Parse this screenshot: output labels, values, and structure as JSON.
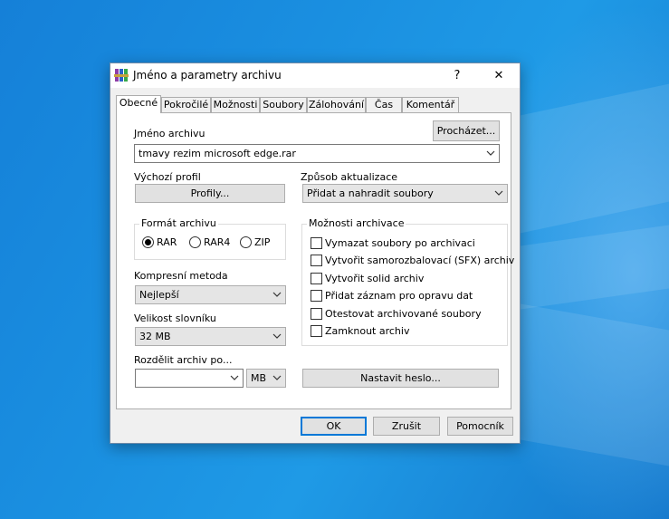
{
  "dialog": {
    "title": "Jméno a parametry archivu",
    "help_glyph": "?",
    "close_glyph": "✕"
  },
  "tabs": [
    "Obecné",
    "Pokročilé",
    "Možnosti",
    "Soubory",
    "Zálohování",
    "Čas",
    "Komentář"
  ],
  "active_tab": "Obecné",
  "archive_name": {
    "label": "Jméno archivu",
    "value": "tmavy rezim microsoft edge.rar",
    "browse_label": "Procházet..."
  },
  "profile": {
    "label": "Výchozí profil",
    "button_label": "Profily..."
  },
  "update_mode": {
    "label": "Způsob aktualizace",
    "value": "Přidat a nahradit soubory"
  },
  "archive_format": {
    "label": "Formát archivu",
    "options": [
      "RAR",
      "RAR4",
      "ZIP"
    ],
    "selected": "RAR"
  },
  "archive_options": {
    "label": "Možnosti archivace",
    "items": [
      {
        "label": "Vymazat soubory po archivaci",
        "checked": false
      },
      {
        "label": "Vytvořit samorozbalovací (SFX) archiv",
        "checked": false
      },
      {
        "label": "Vytvořit solid archiv",
        "checked": false
      },
      {
        "label": "Přidat záznam pro opravu dat",
        "checked": false
      },
      {
        "label": "Otestovat archivované soubory",
        "checked": false
      },
      {
        "label": "Zamknout archiv",
        "checked": false
      }
    ]
  },
  "compression": {
    "label": "Kompresní metoda",
    "value": "Nejlepší"
  },
  "dictionary": {
    "label": "Velikost slovníku",
    "value": "32 MB"
  },
  "split": {
    "label": "Rozdělit archiv po...",
    "value": "",
    "unit": "MB"
  },
  "password_button": "Nastavit heslo...",
  "footer": {
    "ok": "OK",
    "cancel": "Zrušit",
    "help": "Pomocník"
  },
  "colors": {
    "desktop": "#1a8fe0",
    "focus_border": "#0078d7"
  }
}
